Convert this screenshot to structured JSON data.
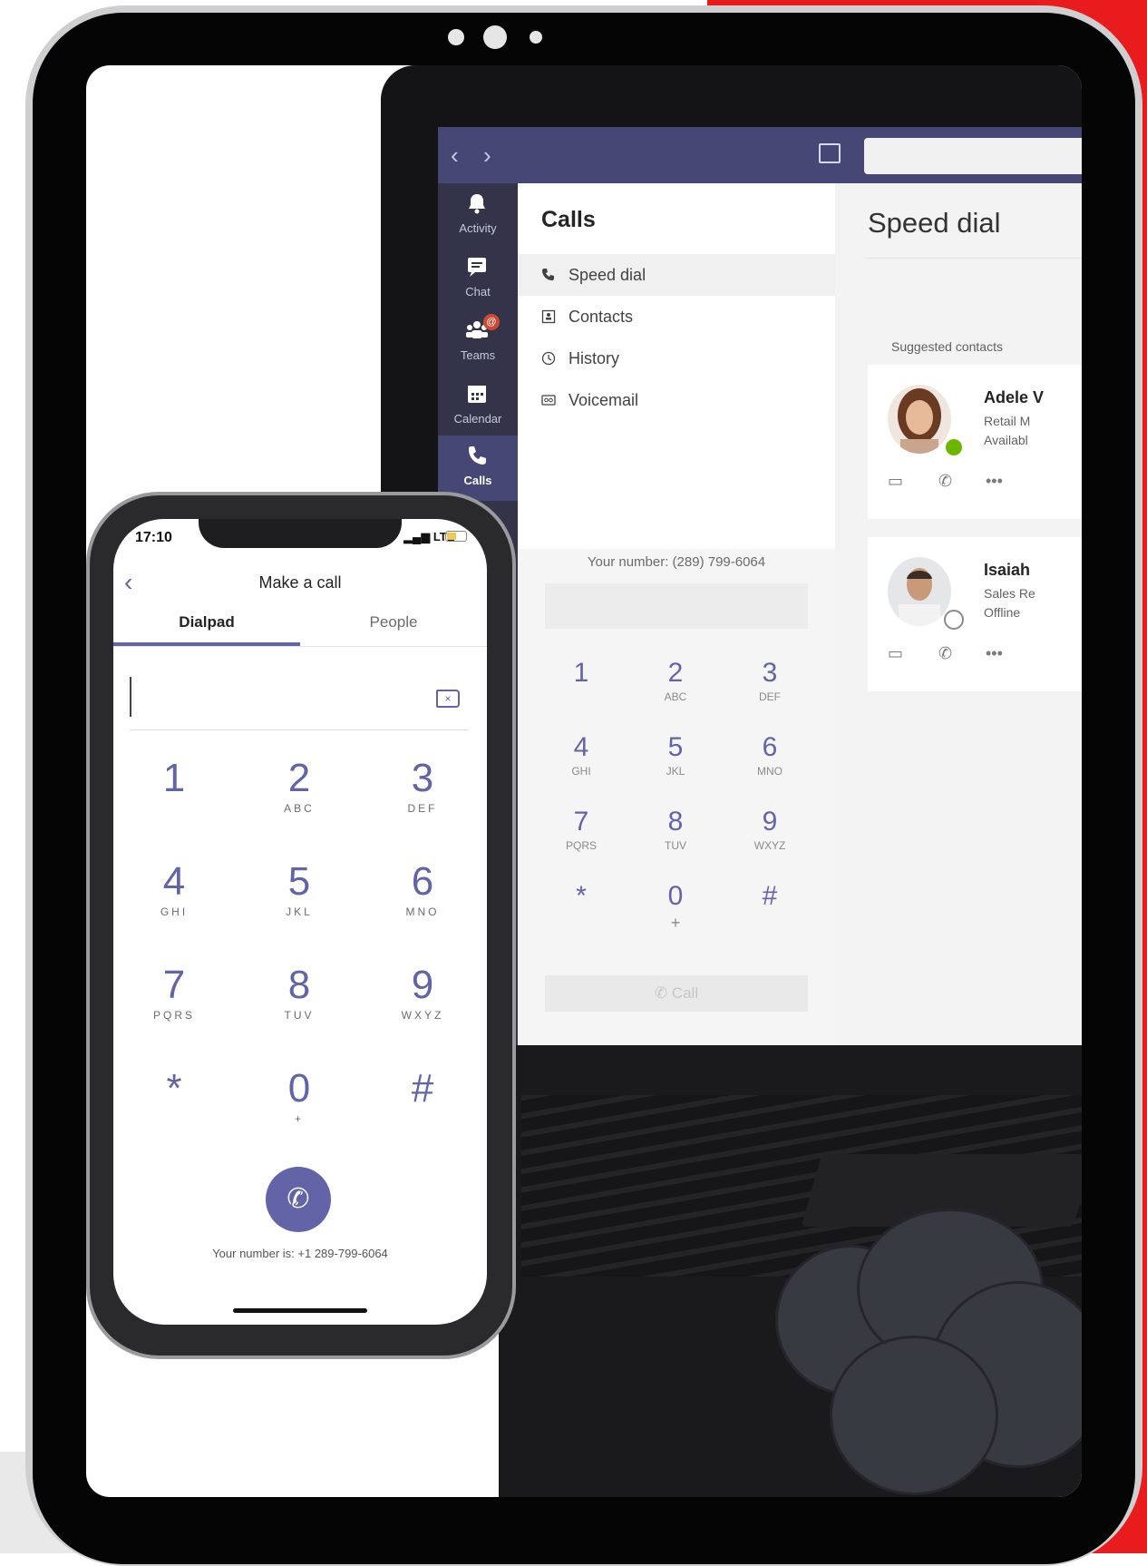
{
  "laptop": {
    "nav": {
      "back": "‹",
      "forward": "›"
    },
    "rail": [
      {
        "label": "Activity",
        "icon": "bell-icon"
      },
      {
        "label": "Chat",
        "icon": "chat-icon"
      },
      {
        "label": "Teams",
        "icon": "teams-icon",
        "badge": "@"
      },
      {
        "label": "Calendar",
        "icon": "calendar-icon"
      },
      {
        "label": "Calls",
        "icon": "phone-icon",
        "active": true
      }
    ],
    "calls": {
      "title": "Calls",
      "menu": [
        {
          "label": "Speed dial",
          "icon": "phone-icon",
          "active": true
        },
        {
          "label": "Contacts",
          "icon": "contacts-icon"
        },
        {
          "label": "History",
          "icon": "clock-icon"
        },
        {
          "label": "Voicemail",
          "icon": "voicemail-icon"
        }
      ]
    },
    "dialpad": {
      "your_number": "Your number: (289) 799-6064",
      "keys": [
        {
          "digit": "1",
          "letters": ""
        },
        {
          "digit": "2",
          "letters": "ABC"
        },
        {
          "digit": "3",
          "letters": "DEF"
        },
        {
          "digit": "4",
          "letters": "GHI"
        },
        {
          "digit": "5",
          "letters": "JKL"
        },
        {
          "digit": "6",
          "letters": "MNO"
        },
        {
          "digit": "7",
          "letters": "PQRS"
        },
        {
          "digit": "8",
          "letters": "TUV"
        },
        {
          "digit": "9",
          "letters": "WXYZ"
        },
        {
          "digit": "*",
          "letters": ""
        },
        {
          "digit": "0",
          "letters": "+"
        },
        {
          "digit": "#",
          "letters": ""
        }
      ],
      "call_label": "Call"
    },
    "speed_dial": {
      "title": "Speed dial",
      "suggested_label": "Suggested contacts",
      "contacts": [
        {
          "name": "Adele V",
          "title": "Retail M",
          "status": "Availabl",
          "presence_color": "#6bb700"
        },
        {
          "name": "Isaiah",
          "title": "Sales Re",
          "status": "Offline",
          "presence_color": "#ffffff"
        }
      ]
    }
  },
  "phone": {
    "time": "17:10",
    "network": "LTE",
    "title": "Make a call",
    "tabs": [
      {
        "label": "Dialpad",
        "active": true
      },
      {
        "label": "People",
        "active": false
      }
    ],
    "keys": [
      {
        "digit": "1",
        "letters": ""
      },
      {
        "digit": "2",
        "letters": "ABC"
      },
      {
        "digit": "3",
        "letters": "DEF"
      },
      {
        "digit": "4",
        "letters": "GHI"
      },
      {
        "digit": "5",
        "letters": "JKL"
      },
      {
        "digit": "6",
        "letters": "MNO"
      },
      {
        "digit": "7",
        "letters": "PQRS"
      },
      {
        "digit": "8",
        "letters": "TUV"
      },
      {
        "digit": "9",
        "letters": "WXYZ"
      },
      {
        "digit": "*",
        "letters": ""
      },
      {
        "digit": "0",
        "letters": "+"
      },
      {
        "digit": "#",
        "letters": ""
      }
    ],
    "your_number": "Your number is: +1 289-799-6064"
  },
  "colors": {
    "teams_purple": "#6264a7",
    "rail_dark": "#33344a",
    "accent_red": "#e81c1c"
  }
}
